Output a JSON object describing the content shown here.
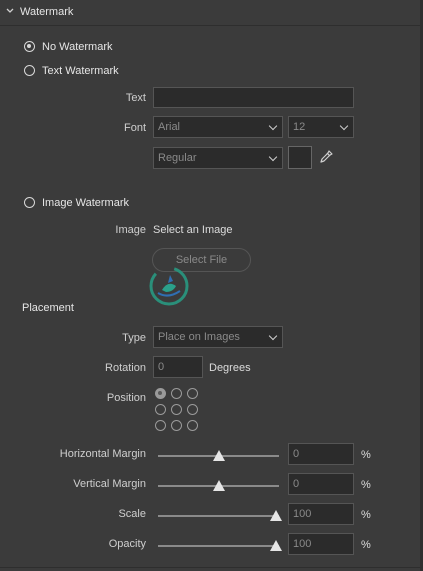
{
  "section": {
    "title": "Watermark"
  },
  "watermark_type": {
    "options": [
      {
        "label": "No Watermark",
        "selected": true
      },
      {
        "label": "Text Watermark",
        "selected": false
      },
      {
        "label": "Image Watermark",
        "selected": false
      }
    ]
  },
  "text_wm": {
    "text_label": "Text",
    "text_value": "",
    "font_label": "Font",
    "font_family": "Arial",
    "font_size": "12",
    "font_style": "Regular"
  },
  "image_wm": {
    "image_label": "Image",
    "image_value": "Select an Image",
    "select_file": "Select File"
  },
  "placement": {
    "title": "Placement",
    "type_label": "Type",
    "type_value": "Place on Images",
    "rotation_label": "Rotation",
    "rotation_value": "0",
    "rotation_unit": "Degrees",
    "position_label": "Position",
    "position_selected_index": 0
  },
  "sliders": [
    {
      "label": "Horizontal Margin",
      "value": "0",
      "unit": "%",
      "fraction": 0.5
    },
    {
      "label": "Vertical Margin",
      "value": "0",
      "unit": "%",
      "fraction": 0.5
    },
    {
      "label": "Scale",
      "value": "100",
      "unit": "%",
      "fraction": 1.0
    },
    {
      "label": "Opacity",
      "value": "100",
      "unit": "%",
      "fraction": 1.0
    }
  ],
  "icons": {
    "collapse": "chevron-down-icon",
    "eyedropper": "eyedropper-icon",
    "logo": "watermark-logo"
  }
}
